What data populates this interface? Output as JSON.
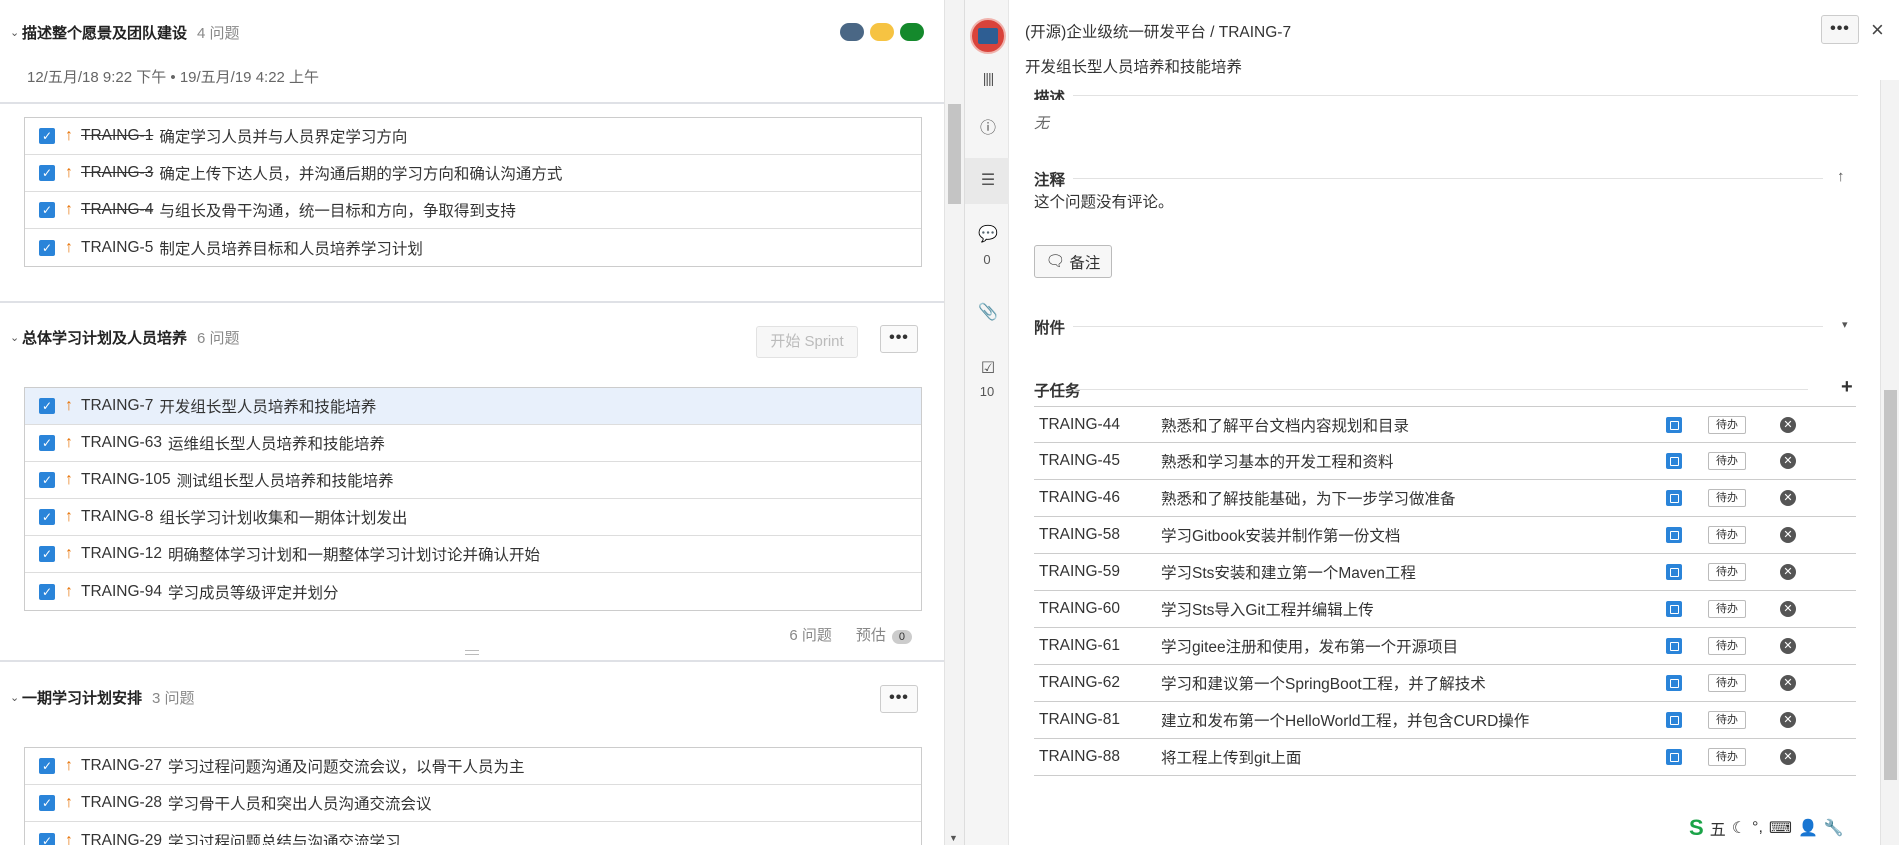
{
  "left": {
    "sprint1": {
      "title": "描述整个愿景及团队建设",
      "count": "4 问题",
      "dates": "12/五月/18 9:22 下午 • 19/五月/19 4:22 上午",
      "dot_colors": [
        "#4a6785",
        "#f6c342",
        "#14892c"
      ],
      "issues": [
        {
          "key": "TRAING-1",
          "summary": "确定学习人员并与人员界定学习方向",
          "done": true
        },
        {
          "key": "TRAING-3",
          "summary": "确定上传下达人员，并沟通后期的学习方向和确认沟通方式",
          "done": true
        },
        {
          "key": "TRAING-4",
          "summary": "与组长及骨干沟通，统一目标和方向，争取得到支持",
          "done": true
        },
        {
          "key": "TRAING-5",
          "summary": "制定人员培养目标和人员培养学习计划",
          "done": false
        }
      ]
    },
    "sprint2": {
      "title": "总体学习计划及人员培养",
      "count": "6 问题",
      "start_label": "开始 Sprint",
      "more_label": "•••",
      "issues": [
        {
          "key": "TRAING-7",
          "summary": "开发组长型人员培养和技能培养",
          "done": false
        },
        {
          "key": "TRAING-63",
          "summary": "运维组长型人员培养和技能培养",
          "done": false
        },
        {
          "key": "TRAING-105",
          "summary": "测试组长型人员培养和技能培养",
          "done": false
        },
        {
          "key": "TRAING-8",
          "summary": "组长学习计划收集和一期体计划发出",
          "done": false
        },
        {
          "key": "TRAING-12",
          "summary": "明确整体学习计划和一期整体学习计划讨论并确认开始",
          "done": false
        },
        {
          "key": "TRAING-94",
          "summary": "学习成员等级评定并划分",
          "done": false
        }
      ],
      "footer_count": "6 问题",
      "estimate_label": "预估",
      "estimate_value": "0"
    },
    "sprint3": {
      "title": "一期学习计划安排",
      "count": "3 问题",
      "more_label": "•••",
      "issues": [
        {
          "key": "TRAING-27",
          "summary": "学习过程问题沟通及问题交流会议，以骨干人员为主",
          "done": false
        },
        {
          "key": "TRAING-28",
          "summary": "学习骨干人员和突出人员沟通交流会议",
          "done": false
        },
        {
          "key": "TRAING-29",
          "summary": "学习过程问题总结与沟通交流学习",
          "done": false
        }
      ]
    }
  },
  "detail": {
    "breadcrumb": "(开源)企业级统一研发平台 / TRAING-7",
    "summary": "开发组长型人员培养和技能培养",
    "more_label": "•••",
    "close_label": "×",
    "rail": {
      "comments_count": "0",
      "subtasks_count": "10"
    },
    "description_title": "描述",
    "description_value": "无",
    "comments_title": "注释",
    "no_comments": "这个问题没有评论。",
    "note_button": "备注",
    "attachments_title": "附件",
    "subtasks_title": "子任务",
    "subtasks": [
      {
        "key": "TRAING-44",
        "summary": "熟悉和了解平台文档内容规划和目录",
        "status": "待办"
      },
      {
        "key": "TRAING-45",
        "summary": "熟悉和学习基本的开发工程和资料",
        "status": "待办"
      },
      {
        "key": "TRAING-46",
        "summary": "熟悉和了解技能基础，为下一步学习做准备",
        "status": "待办"
      },
      {
        "key": "TRAING-58",
        "summary": "学习Gitbook安装并制作第一份文档",
        "status": "待办"
      },
      {
        "key": "TRAING-59",
        "summary": "学习Sts安装和建立第一个Maven工程",
        "status": "待办"
      },
      {
        "key": "TRAING-60",
        "summary": "学习Sts导入Git工程并编辑上传",
        "status": "待办"
      },
      {
        "key": "TRAING-61",
        "summary": "学习gitee注册和使用，发布第一个开源项目",
        "status": "待办"
      },
      {
        "key": "TRAING-62",
        "summary": "学习和建议第一个SpringBoot工程，并了解技术",
        "status": "待办"
      },
      {
        "key": "TRAING-81",
        "summary": "建立和发布第一个HelloWorld工程，并包含CURD操作",
        "status": "待办"
      },
      {
        "key": "TRAING-88",
        "summary": "将工程上传到git上面",
        "status": "待办"
      }
    ]
  },
  "ime": {
    "logo": "S",
    "mode": "五"
  }
}
